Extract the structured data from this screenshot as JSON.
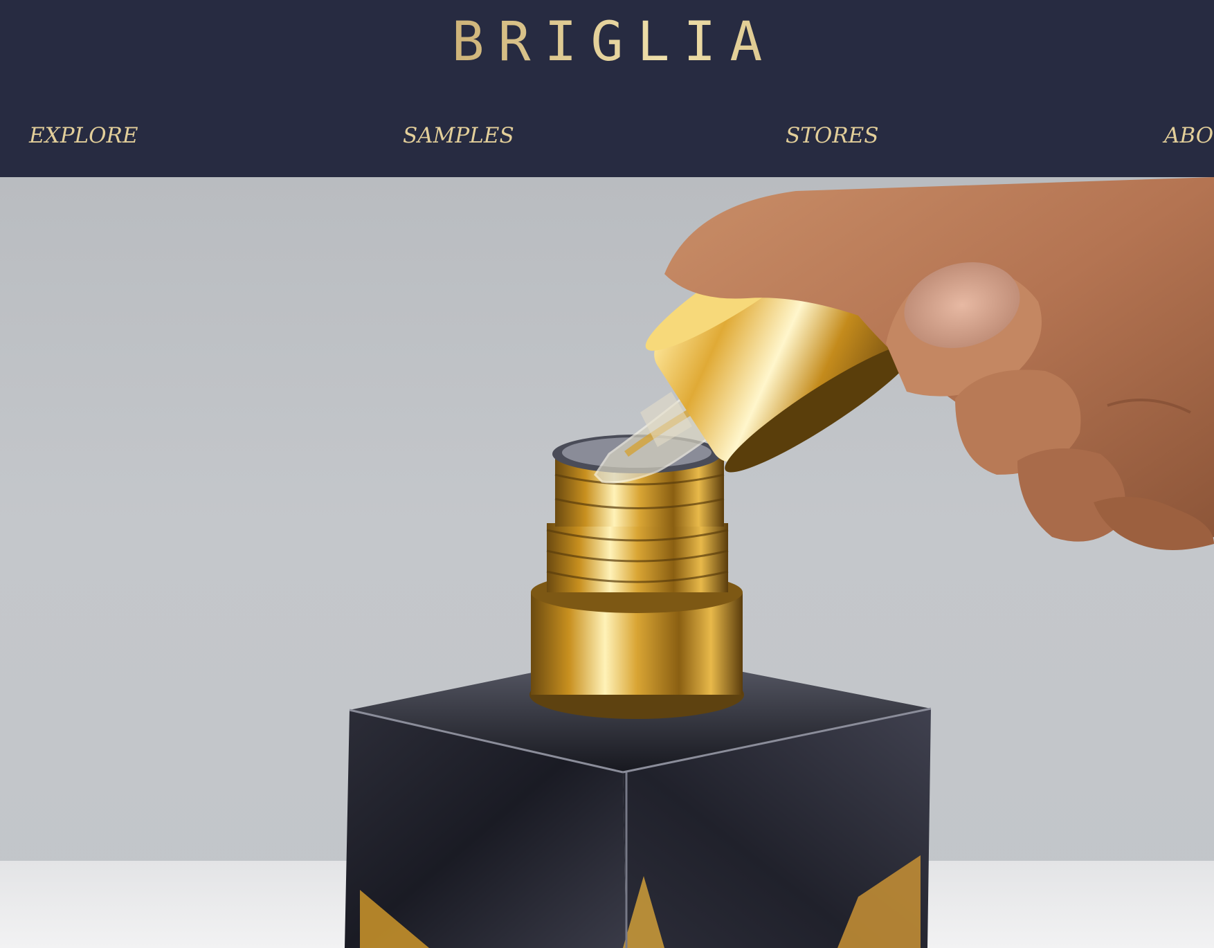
{
  "brand": {
    "logo_text": "BRIGLIA"
  },
  "nav": {
    "items": [
      {
        "label": "EXPLORE"
      },
      {
        "label": "SAMPLES"
      },
      {
        "label": "STORES"
      },
      {
        "label": "ABOUT"
      }
    ]
  },
  "hero": {
    "image_subject": "hand-dropper-perfume-bottle"
  },
  "colors": {
    "header_background": "#272b41",
    "nav_text": "#e3cf9a",
    "logo_gold": "#c9ad72"
  }
}
